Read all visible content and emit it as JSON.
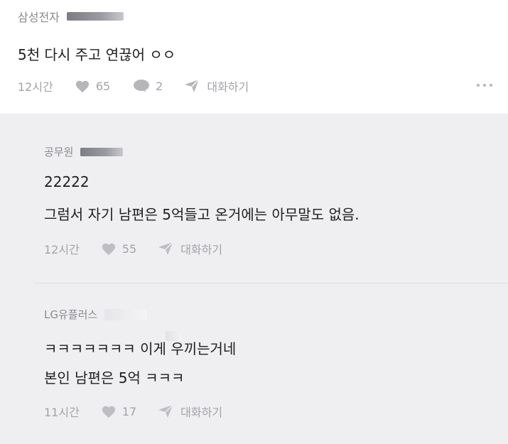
{
  "post": {
    "author": "삼성전자",
    "text": "5천 다시 주고 연끊어 ㅇㅇ",
    "time": "12시간",
    "likes": "65",
    "comments": "2",
    "reply_label": "대화하기"
  },
  "replies": [
    {
      "author": "공무원",
      "lines": [
        "22222",
        "그럼서 자기 남편은 5억들고 온거에는 아무말도 없음."
      ],
      "time": "12시간",
      "likes": "55",
      "reply_label": "대화하기"
    },
    {
      "author": "LG유플러스",
      "lines": [
        "ㅋㅋㅋㅋㅋㅋㅋ 이게 우끼는거네",
        "본인 남편은 5억 ㅋㅋㅋ"
      ],
      "time": "11시간",
      "likes": "17",
      "reply_label": "대화하기"
    }
  ],
  "colors": {
    "post_bg": "#ffffff",
    "reply_bg": "#efeff1",
    "meta_gray": "#a3a3a8",
    "text": "#1e1e1e"
  }
}
